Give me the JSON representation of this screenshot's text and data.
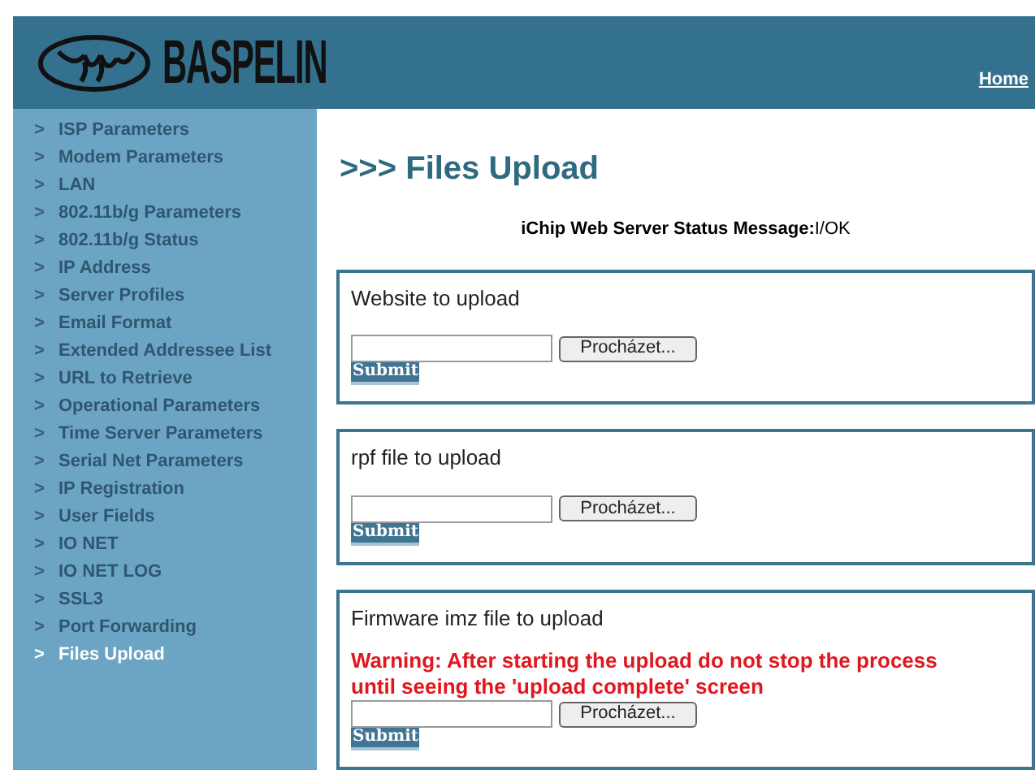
{
  "header": {
    "logo_text": "BASPELIN",
    "home_link": "Home"
  },
  "sidebar": {
    "items": [
      {
        "arrow": ">",
        "label": "ISP Parameters",
        "selected": false
      },
      {
        "arrow": ">",
        "label": "Modem Parameters",
        "selected": false
      },
      {
        "arrow": ">",
        "label": "LAN",
        "selected": false
      },
      {
        "arrow": ">",
        "label": "802.11b/g Parameters",
        "selected": false
      },
      {
        "arrow": ">",
        "label": "802.11b/g Status",
        "selected": false
      },
      {
        "arrow": ">",
        "label": "IP Address",
        "selected": false
      },
      {
        "arrow": ">",
        "label": "Server Profiles",
        "selected": false
      },
      {
        "arrow": ">",
        "label": "Email Format",
        "selected": false
      },
      {
        "arrow": ">",
        "label": "Extended Addressee List",
        "selected": false
      },
      {
        "arrow": ">",
        "label": "URL to Retrieve",
        "selected": false
      },
      {
        "arrow": ">",
        "label": "Operational Parameters",
        "selected": false
      },
      {
        "arrow": ">",
        "label": "Time Server Parameters",
        "selected": false
      },
      {
        "arrow": ">",
        "label": "Serial Net Parameters",
        "selected": false
      },
      {
        "arrow": ">",
        "label": "IP Registration",
        "selected": false
      },
      {
        "arrow": ">",
        "label": "User Fields",
        "selected": false
      },
      {
        "arrow": ">",
        "label": "IO NET",
        "selected": false
      },
      {
        "arrow": ">",
        "label": "IO NET LOG",
        "selected": false
      },
      {
        "arrow": ">",
        "label": "SSL3",
        "selected": false
      },
      {
        "arrow": ">",
        "label": "Port Forwarding",
        "selected": false
      },
      {
        "arrow": ">",
        "label": "Files Upload",
        "selected": true
      }
    ]
  },
  "page_title": ">>> Files Upload",
  "status_message": "**iChip Web Server Status Message:**I/OK",
  "upload_sections": [
    {
      "label": "Website to upload",
      "browse_button": "Procházet...",
      "submit_button": "Submit"
    },
    {
      "label": "rpf file to upload",
      "browse_button": "Procházet...",
      "submit_button": "Submit"
    },
    {
      "label": "Firmware imz file to upload",
      "warning": "Warning: After starting the upload do not stop the process until seeing the 'upload complete' screen",
      "browse_button": "Procházet...",
      "submit_button": "Submit"
    }
  ]
}
